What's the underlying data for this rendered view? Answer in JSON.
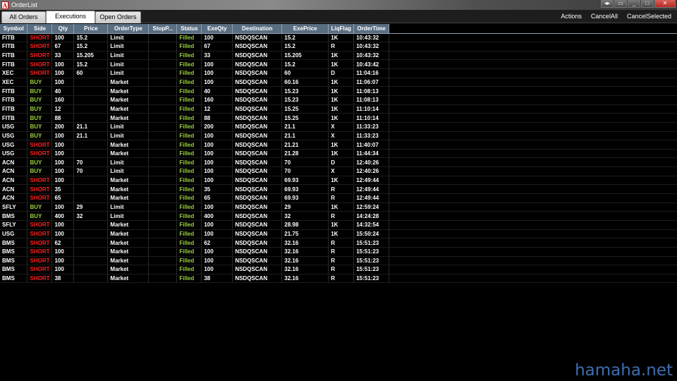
{
  "window": {
    "title": "OrderList",
    "app_icon_glyph": "A"
  },
  "tabs": [
    "All Orders",
    "Executions",
    "Open Orders"
  ],
  "active_tab": "Executions",
  "actions": [
    "Actions",
    "CancelAll",
    "CancelSelected"
  ],
  "columns": [
    "Symbol",
    "Side",
    "Qty",
    "Price",
    "OrderType",
    "StopP...",
    "Status",
    "ExeQty",
    "Destination",
    "ExePrice",
    "LiqFlag",
    "OrderTime"
  ],
  "rows": [
    [
      "FITB",
      "SHORT",
      "100",
      "15.2",
      "Limit",
      "",
      "Filled",
      "100",
      "NSDQSCAN",
      "15.2",
      "1K",
      "10:43:32"
    ],
    [
      "FITB",
      "SHORT",
      "67",
      "15.2",
      "Limit",
      "",
      "Filled",
      "67",
      "NSDQSCAN",
      "15.2",
      "R",
      "10:43:32"
    ],
    [
      "FITB",
      "SHORT",
      "33",
      "15.205",
      "Limit",
      "",
      "Filled",
      "33",
      "NSDQSCAN",
      "15.205",
      "1K",
      "10:43:32"
    ],
    [
      "FITB",
      "SHORT",
      "100",
      "15.2",
      "Limit",
      "",
      "Filled",
      "100",
      "NSDQSCAN",
      "15.2",
      "1K",
      "10:43:42"
    ],
    [
      "XEC",
      "SHORT",
      "100",
      "60",
      "Limit",
      "",
      "Filled",
      "100",
      "NSDQSCAN",
      "60",
      "D",
      "11:04:16"
    ],
    [
      "XEC",
      "BUY",
      "100",
      "",
      "Market",
      "",
      "Filled",
      "100",
      "NSDQSCAN",
      "60.16",
      "1K",
      "11:06:07"
    ],
    [
      "FITB",
      "BUY",
      "40",
      "",
      "Market",
      "",
      "Filled",
      "40",
      "NSDQSCAN",
      "15.23",
      "1K",
      "11:08:13"
    ],
    [
      "FITB",
      "BUY",
      "160",
      "",
      "Market",
      "",
      "Filled",
      "160",
      "NSDQSCAN",
      "15.23",
      "1K",
      "11:08:13"
    ],
    [
      "FITB",
      "BUY",
      "12",
      "",
      "Market",
      "",
      "Filled",
      "12",
      "NSDQSCAN",
      "15.25",
      "1K",
      "11:10:14"
    ],
    [
      "FITB",
      "BUY",
      "88",
      "",
      "Market",
      "",
      "Filled",
      "88",
      "NSDQSCAN",
      "15.25",
      "1K",
      "11:10:14"
    ],
    [
      "USG",
      "BUY",
      "200",
      "21.1",
      "Limit",
      "",
      "Filled",
      "200",
      "NSDQSCAN",
      "21.1",
      "X",
      "11:33:23"
    ],
    [
      "USG",
      "BUY",
      "100",
      "21.1",
      "Limit",
      "",
      "Filled",
      "100",
      "NSDQSCAN",
      "21.1",
      "X",
      "11:33:23"
    ],
    [
      "USG",
      "SHORT",
      "100",
      "",
      "Market",
      "",
      "Filled",
      "100",
      "NSDQSCAN",
      "21.21",
      "1K",
      "11:40:07"
    ],
    [
      "USG",
      "SHORT",
      "100",
      "",
      "Market",
      "",
      "Filled",
      "100",
      "NSDQSCAN",
      "21.28",
      "1K",
      "11:44:34"
    ],
    [
      "ACN",
      "BUY",
      "100",
      "70",
      "Limit",
      "",
      "Filled",
      "100",
      "NSDQSCAN",
      "70",
      "D",
      "12:40:26"
    ],
    [
      "ACN",
      "BUY",
      "100",
      "70",
      "Limit",
      "",
      "Filled",
      "100",
      "NSDQSCAN",
      "70",
      "X",
      "12:40:26"
    ],
    [
      "ACN",
      "SHORT",
      "100",
      "",
      "Market",
      "",
      "Filled",
      "100",
      "NSDQSCAN",
      "69.93",
      "1K",
      "12:49:44"
    ],
    [
      "ACN",
      "SHORT",
      "35",
      "",
      "Market",
      "",
      "Filled",
      "35",
      "NSDQSCAN",
      "69.93",
      "R",
      "12:49:44"
    ],
    [
      "ACN",
      "SHORT",
      "65",
      "",
      "Market",
      "",
      "Filled",
      "65",
      "NSDQSCAN",
      "69.93",
      "R",
      "12:49:44"
    ],
    [
      "SFLY",
      "BUY",
      "100",
      "29",
      "Limit",
      "",
      "Filled",
      "100",
      "NSDQSCAN",
      "29",
      "1K",
      "12:59:24"
    ],
    [
      "BMS",
      "BUY",
      "400",
      "32",
      "Limit",
      "",
      "Filled",
      "400",
      "NSDQSCAN",
      "32",
      "R",
      "14:24:28"
    ],
    [
      "SFLY",
      "SHORT",
      "100",
      "",
      "Market",
      "",
      "Filled",
      "100",
      "NSDQSCAN",
      "28.98",
      "1K",
      "14:32:54"
    ],
    [
      "USG",
      "SHORT",
      "100",
      "",
      "Market",
      "",
      "Filled",
      "100",
      "NSDQSCAN",
      "21.75",
      "1K",
      "15:50:24"
    ],
    [
      "BMS",
      "SHORT",
      "62",
      "",
      "Market",
      "",
      "Filled",
      "62",
      "NSDQSCAN",
      "32.16",
      "R",
      "15:51:23"
    ],
    [
      "BMS",
      "SHORT",
      "100",
      "",
      "Market",
      "",
      "Filled",
      "100",
      "NSDQSCAN",
      "32.16",
      "R",
      "15:51:23"
    ],
    [
      "BMS",
      "SHORT",
      "100",
      "",
      "Market",
      "",
      "Filled",
      "100",
      "NSDQSCAN",
      "32.16",
      "R",
      "15:51:23"
    ],
    [
      "BMS",
      "SHORT",
      "100",
      "",
      "Market",
      "",
      "Filled",
      "100",
      "NSDQSCAN",
      "32.16",
      "R",
      "15:51:23"
    ],
    [
      "BMS",
      "SHORT",
      "38",
      "",
      "Market",
      "",
      "Filled",
      "38",
      "NSDQSCAN",
      "32.16",
      "R",
      "15:51:23"
    ]
  ],
  "colors": {
    "short": "#ff1e1e",
    "buy": "#9bd23b",
    "filled": "#9bd23b",
    "header_bg": "#5a6e82"
  },
  "watermark": "hamaha.net"
}
